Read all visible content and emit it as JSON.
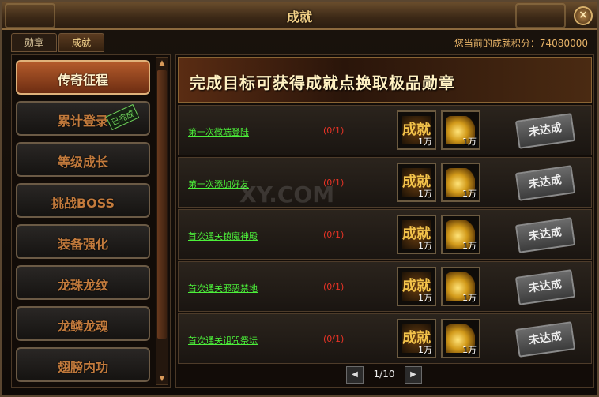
{
  "window": {
    "title": "成就",
    "close_icon": "×"
  },
  "tabs": [
    {
      "label": "勋章"
    },
    {
      "label": "成就"
    }
  ],
  "score_text": "您当前的成就积分：74080000",
  "categories": [
    {
      "label": "传奇征程",
      "active": true
    },
    {
      "label": "累计登录",
      "badge": "已完成"
    },
    {
      "label": "等级成长"
    },
    {
      "label": "挑战BOSS"
    },
    {
      "label": "装备强化"
    },
    {
      "label": "龙珠龙纹"
    },
    {
      "label": "龙鳞龙魂"
    },
    {
      "label": "翅膀内功"
    }
  ],
  "banner": {
    "text": "完成目标可获得成就点换取极品勋章"
  },
  "watermark": "XY.COM",
  "achievements": [
    {
      "name": "第一次微端登陆",
      "progress": "(0/1)",
      "reward1_icon": "成就",
      "reward1_amount": "1万",
      "reward2_icon": "gold-coins",
      "reward2_amount": "1万",
      "status": "未达成"
    },
    {
      "name": "第一次添加好友",
      "progress": "(0/1)",
      "reward1_icon": "成就",
      "reward1_amount": "1万",
      "reward2_icon": "gold-coins",
      "reward2_amount": "1万",
      "status": "未达成"
    },
    {
      "name": "首次通关镇魔神殿",
      "progress": "(0/1)",
      "reward1_icon": "成就",
      "reward1_amount": "1万",
      "reward2_icon": "gold-coins",
      "reward2_amount": "1万",
      "status": "未达成"
    },
    {
      "name": "首次通关邪恶禁地",
      "progress": "(0/1)",
      "reward1_icon": "成就",
      "reward1_amount": "1万",
      "reward2_icon": "gold-coins",
      "reward2_amount": "1万",
      "status": "未达成"
    },
    {
      "name": "首次通关诅咒祭坛",
      "progress": "(0/1)",
      "reward1_icon": "成就",
      "reward1_amount": "1万",
      "reward2_icon": "gold-coins",
      "reward2_amount": "1万",
      "status": "未达成"
    }
  ],
  "pager": {
    "text": "1/10",
    "prev_icon": "◀",
    "next_icon": "▶"
  },
  "scroll": {
    "up_icon": "▲",
    "down_icon": "▼"
  },
  "colors": {
    "accent": "#f3d187",
    "link": "#4cf03a",
    "progress": "#e83326",
    "score": "#e8b468"
  }
}
